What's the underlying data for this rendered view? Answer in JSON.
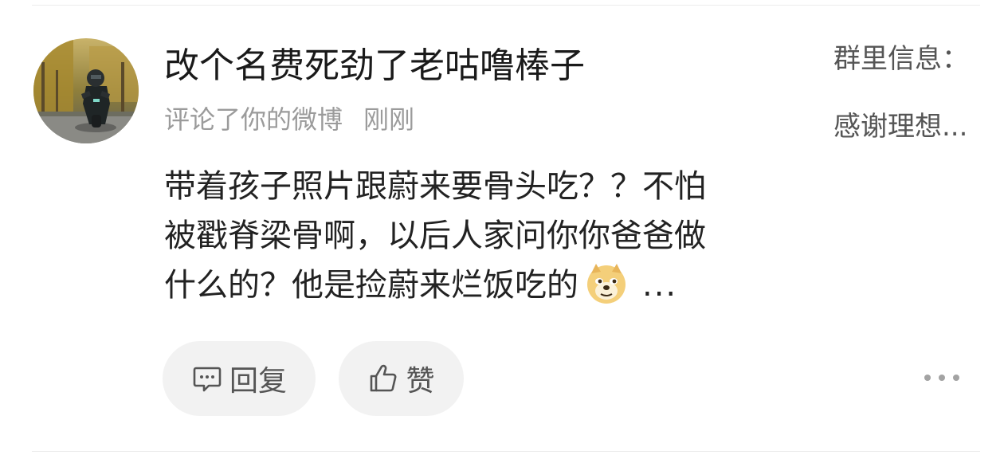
{
  "notification": {
    "username": "改个名费死劲了老咕噜棒子",
    "action": "评论了你的微博",
    "time": "刚刚",
    "comment_lines": [
      "带着孩子照片跟蔚来要骨头吃？？不怕",
      "被戳脊梁骨啊，以后人家问你你爸爸做",
      "什么的？他是捡蔚来烂饭吃的"
    ],
    "comment_emoji": "doge-emoji",
    "comment_ellipsis": "...",
    "reply_label": "回复",
    "like_label": "赞",
    "preview_line1": "群里信息：",
    "preview_line2": "感谢理想..."
  },
  "icons": {
    "reply": "comment-bubble-icon",
    "like": "thumbs-up-icon",
    "more": "more-horizontal-icon"
  },
  "colors": {
    "primary_text": "#1a1a1a",
    "secondary_text": "#9b9b9b",
    "pill_bg": "#f2f2f2",
    "divider": "#ececec"
  }
}
